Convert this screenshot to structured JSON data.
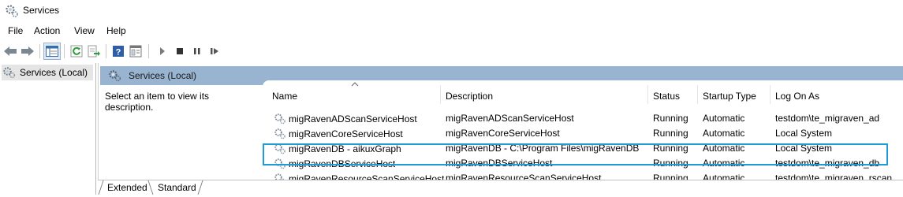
{
  "window": {
    "title": "Services",
    "icon": "gears-icon"
  },
  "menu": [
    "File",
    "Action",
    "View",
    "Help"
  ],
  "toolbar": {
    "buttons": [
      "back-arrow-icon",
      "forward-arrow-icon",
      "extended-view-icon",
      "refresh-icon",
      "export-icon",
      "help-icon",
      "properties-icon",
      "play-icon",
      "stop-icon",
      "pause-icon",
      "restart-icon"
    ]
  },
  "tree": {
    "node_label": "Services (Local)"
  },
  "pane": {
    "header_title": "Services (Local)",
    "description_prompt": "Select an item to view its description."
  },
  "columns": {
    "name": "Name",
    "description": "Description",
    "status": "Status",
    "startup_type": "Startup Type",
    "log_on_as": "Log On As"
  },
  "services": [
    {
      "name": "migRavenADScanServiceHost",
      "description": "migRavenADScanServiceHost",
      "status": "Running",
      "startup_type": "Automatic",
      "log_on_as": "testdom\\te_migraven_ad"
    },
    {
      "name": "migRavenCoreServiceHost",
      "description": "migRavenCoreServiceHost",
      "status": "Running",
      "startup_type": "Automatic",
      "log_on_as": "Local System"
    },
    {
      "name": "migRavenDB - aikuxGraph",
      "description": "migRavenDB - C:\\Program Files\\migRavenDB",
      "status": "Running",
      "startup_type": "Automatic",
      "log_on_as": "Local System"
    },
    {
      "name": "migRavenDBServiceHost",
      "description": "migRavenDBServiceHost",
      "status": "Running",
      "startup_type": "Automatic",
      "log_on_as": "testdom\\te_migraven_db"
    },
    {
      "name": "migRavenResourceScanServiceHost",
      "description": "migRavenResourceScanServiceHost",
      "status": "Running",
      "startup_type": "Automatic",
      "log_on_as": "testdom\\te_migraven_rscan"
    }
  ],
  "tabs": [
    "Extended",
    "Standard"
  ],
  "colors": {
    "accent_highlight": "#1f9ad6",
    "header_bg": "#99b4d1"
  }
}
